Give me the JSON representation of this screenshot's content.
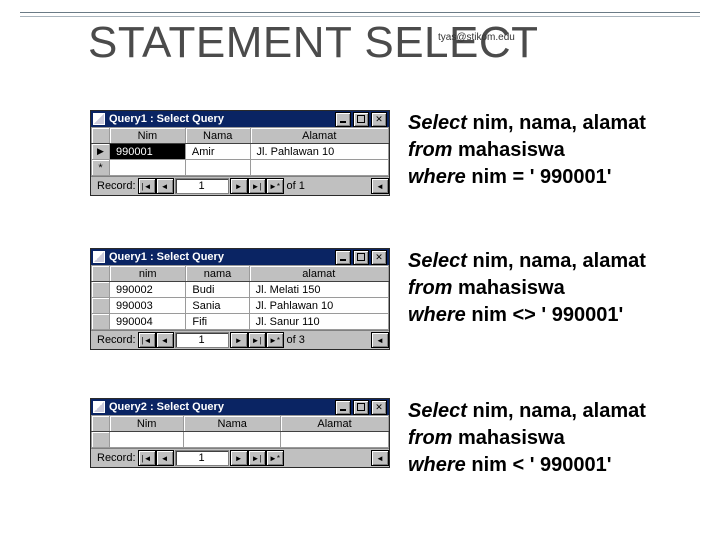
{
  "title": "STATEMENT SELECT",
  "watermark": "tyas@stikom.edu",
  "windows": [
    {
      "caption": "Query1 : Select Query",
      "headers": [
        "Nim",
        "Nama",
        "Alamat"
      ],
      "rows": [
        {
          "marker": "▶",
          "c0": "990001",
          "c1": "Amir",
          "c2": "Jl. Pahlawan 10",
          "sel": true
        },
        {
          "marker": "*",
          "c0": "",
          "c1": "",
          "c2": ""
        }
      ],
      "rec_value": "1",
      "rec_of": "of 1"
    },
    {
      "caption": "Query1 : Select Query",
      "headers": [
        "nim",
        "nama",
        "alamat"
      ],
      "rows": [
        {
          "marker": "",
          "c0": "990002",
          "c1": "Budi",
          "c2": "Jl. Melati 150"
        },
        {
          "marker": "",
          "c0": "990003",
          "c1": "Sania",
          "c2": "Jl. Pahlawan 10"
        },
        {
          "marker": "",
          "c0": "990004",
          "c1": "Fifi",
          "c2": "Jl. Sanur 110"
        }
      ],
      "rec_value": "1",
      "rec_of": "of 3"
    },
    {
      "caption": "Query2 : Select Query",
      "headers": [
        "Nim",
        "Nama",
        "Alamat"
      ],
      "rows": [
        {
          "marker": "",
          "c0": "",
          "c1": "",
          "c2": ""
        }
      ],
      "rec_value": "1",
      "rec_of": ""
    }
  ],
  "sql": [
    {
      "select": "Select ",
      "cols": "nim, nama, alamat",
      "from": "from ",
      "tbl": "mahasiswa",
      "where": "where ",
      "cond": "nim = ' 990001'"
    },
    {
      "select": "Select ",
      "cols": "nim, nama, alamat",
      "from": "from ",
      "tbl": "mahasiswa",
      "where": "where ",
      "cond": "nim <>  ' 990001'"
    },
    {
      "select": "Select ",
      "cols": "nim, nama, alamat",
      "from": "from ",
      "tbl": "mahasiswa",
      "where": "where ",
      "cond": "nim <  ' 990001'"
    }
  ],
  "nav": {
    "first": "|◄",
    "prev": "◄",
    "next": "►",
    "last": "►|",
    "new": "►*",
    "scroll": "◄",
    "rec": "Record:"
  }
}
